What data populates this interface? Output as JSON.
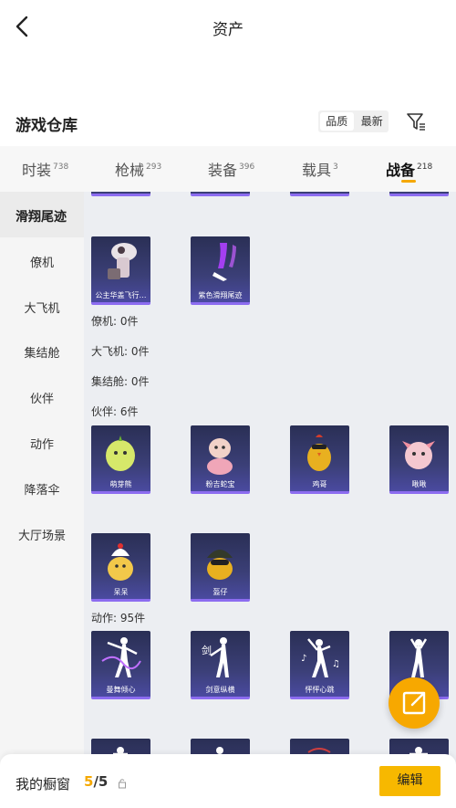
{
  "header": {
    "title": "资产"
  },
  "section": {
    "title": "游戏仓库"
  },
  "sort": {
    "options": [
      "品质",
      "最新"
    ],
    "active": "品质"
  },
  "tabs": [
    {
      "label": "时装",
      "count": "738"
    },
    {
      "label": "枪械",
      "count": "293"
    },
    {
      "label": "装备",
      "count": "396"
    },
    {
      "label": "载具",
      "count": "3"
    },
    {
      "label": "战备",
      "count": "218"
    }
  ],
  "active_tab": "战备",
  "sidebar": {
    "active": "滑翔尾迹",
    "items": [
      "僚机",
      "大飞机",
      "集结舱",
      "伙伴",
      "动作",
      "降落伞",
      "大厅场景"
    ]
  },
  "content": {
    "glide_items": [
      "公主华盖飞行…",
      "紫色滑翔尾迹"
    ],
    "groups": {
      "wingman": "僚机: 0件",
      "bigplane": "大飞机: 0件",
      "pod": "集结舱: 0件",
      "partner": "伙伴: 6件",
      "emote": "动作: 95件"
    },
    "partners": [
      "萌芽熊",
      "粉吉蛇宝",
      "鸡哥",
      "啾啾",
      "呆呆",
      "盔仔"
    ],
    "emotes": [
      "曼舞倾心",
      "剑意纵横",
      "怦怦心跳",
      ""
    ]
  },
  "bottom": {
    "label": "我的橱窗",
    "current": "5",
    "total": "/5",
    "edit": "编辑"
  },
  "colors": {
    "accent": "#f5a800",
    "card": "#3b3f77",
    "card_border": "#8c6cf0"
  }
}
